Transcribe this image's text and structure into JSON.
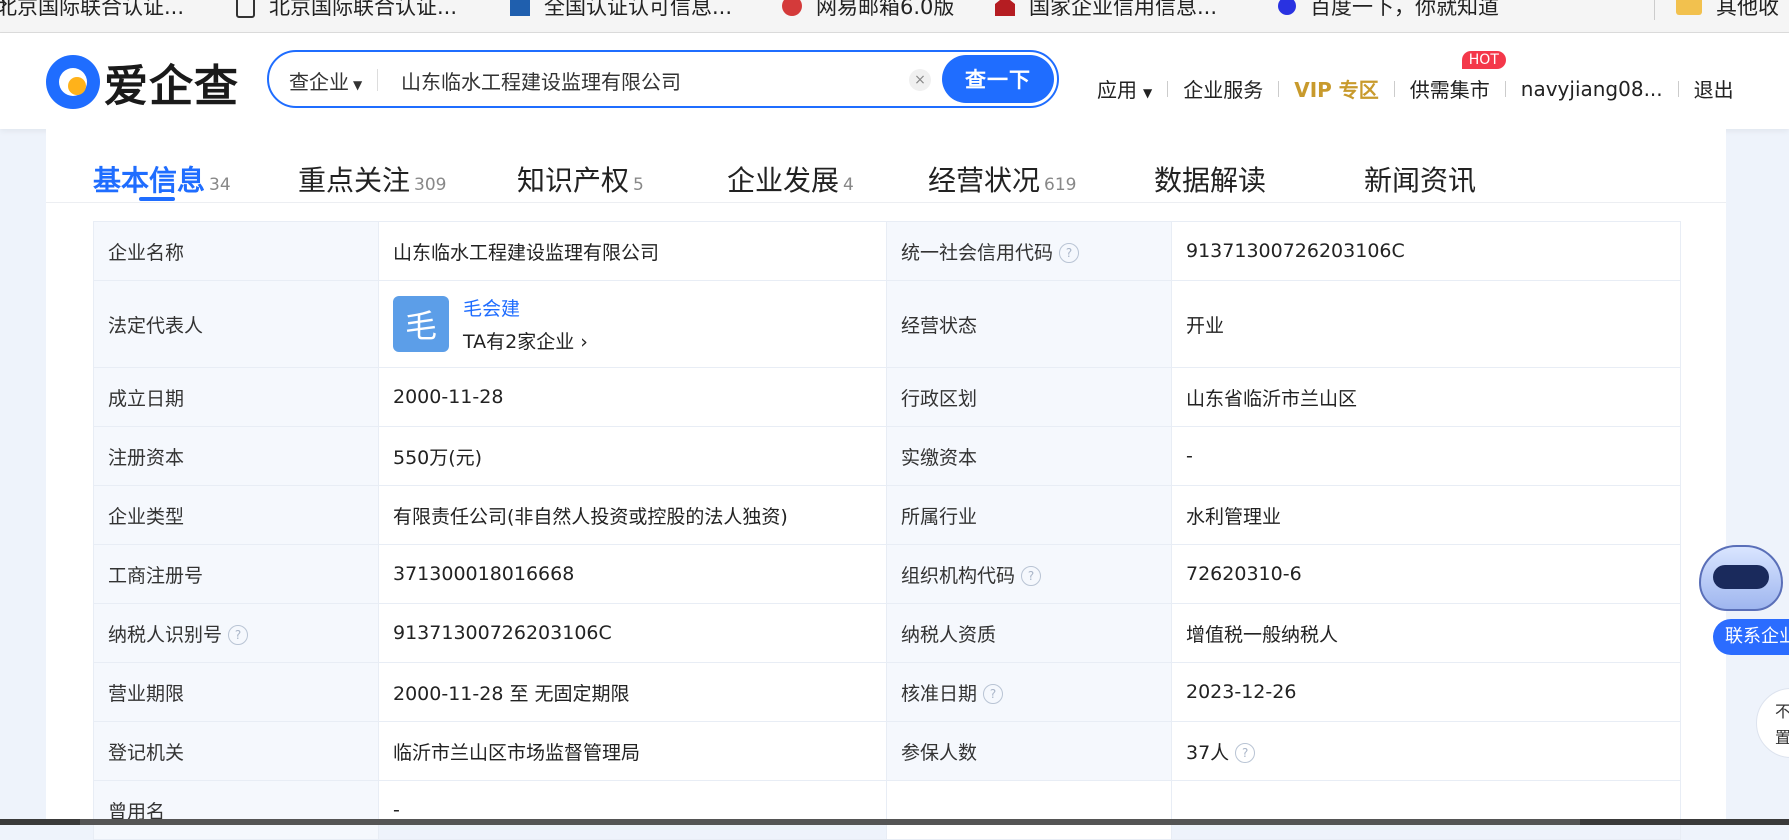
{
  "bookmarks": [
    {
      "label": "北京国际联合认证..."
    },
    {
      "label": "北京国际联合认证..."
    },
    {
      "label": "全国认证认可信息..."
    },
    {
      "label": "网易邮箱6.0版"
    },
    {
      "label": "国家企业信用信息..."
    },
    {
      "label": "百度一下，你就知道"
    },
    {
      "label": "其他收"
    }
  ],
  "logo": {
    "text": "爱企查"
  },
  "search": {
    "type_label": "查企业",
    "value": "山东临水工程建设监理有限公司",
    "button_label": "查一下",
    "clear_label": "×"
  },
  "nav": {
    "apps": "应用",
    "enterprise_service": "企业服务",
    "vip_prefix": "VIP",
    "vip_suffix": "专区",
    "market": "供需集市",
    "hot_badge": "HOT",
    "username": "navyjiang08...",
    "logout": "退出"
  },
  "tabs": [
    {
      "label": "基本信息",
      "count": "34"
    },
    {
      "label": "重点关注",
      "count": "309"
    },
    {
      "label": "知识产权",
      "count": "5"
    },
    {
      "label": "企业发展",
      "count": "4"
    },
    {
      "label": "经营状况",
      "count": "619"
    },
    {
      "label": "数据解读",
      "count": ""
    },
    {
      "label": "新闻资讯",
      "count": ""
    }
  ],
  "info": {
    "company_name_key": "企业名称",
    "company_name_val": "山东临水工程建设监理有限公司",
    "credit_code_key": "统一社会信用代码",
    "credit_code_val": "91371300726203106C",
    "legal_rep_key": "法定代表人",
    "legal_rep_avatar": "毛",
    "legal_rep_name": "毛会建",
    "legal_rep_link": "TA有2家企业 ›",
    "status_key": "经营状态",
    "status_val": "开业",
    "founded_key": "成立日期",
    "founded_val": "2000-11-28",
    "region_key": "行政区划",
    "region_val": "山东省临沂市兰山区",
    "reg_capital_key": "注册资本",
    "reg_capital_val": "550万(元)",
    "paid_capital_key": "实缴资本",
    "paid_capital_val": "-",
    "type_key": "企业类型",
    "type_val": "有限责任公司(非自然人投资或控股的法人独资)",
    "industry_key": "所属行业",
    "industry_val": "水利管理业",
    "biz_reg_no_key": "工商注册号",
    "biz_reg_no_val": "371300018016668",
    "org_code_key": "组织机构代码",
    "org_code_val": "72620310-6",
    "taxpayer_id_key": "纳税人识别号",
    "taxpayer_id_val": "91371300726203106C",
    "taxpayer_qual_key": "纳税人资质",
    "taxpayer_qual_val": "增值税一般纳税人",
    "term_key": "营业期限",
    "term_val": "2000-11-28 至 无固定期限",
    "approved_key": "核准日期",
    "approved_val": "2023-12-26",
    "authority_key": "登记机关",
    "authority_val": "临沂市兰山区市场监督管理局",
    "insured_key": "参保人数",
    "insured_val": "37人",
    "former_name_key": "曾用名",
    "former_name_val": "-",
    "help_glyph": "?"
  },
  "widgets": {
    "contact_label": "联系企业",
    "top_label_1": "不",
    "top_label_2": "置"
  },
  "colors": {
    "accent": "#1f6dff",
    "vip": "#c89a2c",
    "hot": "#f4384a"
  }
}
